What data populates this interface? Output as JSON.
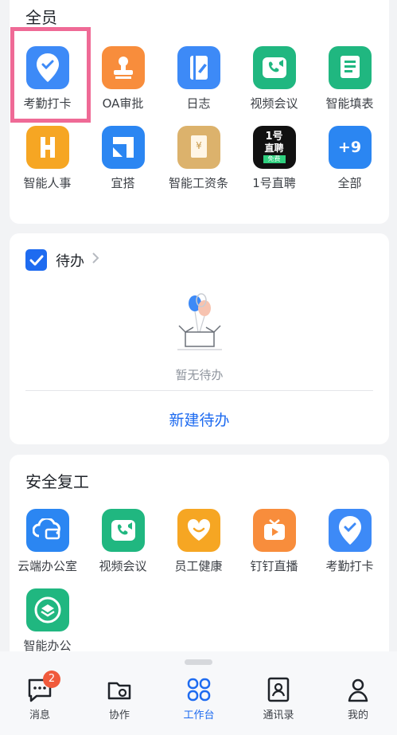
{
  "sections": {
    "all": {
      "title": "全员",
      "apps": [
        {
          "label": "考勤打卡",
          "icon": "location-check-icon",
          "color": "#3d8af7"
        },
        {
          "label": "OA审批",
          "icon": "stamp-icon",
          "color": "#f88d3c"
        },
        {
          "label": "日志",
          "icon": "journal-edit-icon",
          "color": "#3d8af7"
        },
        {
          "label": "视频会议",
          "icon": "video-call-icon",
          "color": "#20b780"
        },
        {
          "label": "智能填表",
          "icon": "form-icon",
          "color": "#20b780"
        },
        {
          "label": "智能人事",
          "icon": "h-icon",
          "color": "#f6a623"
        },
        {
          "label": "宜搭",
          "icon": "yida-icon",
          "color": "#2b86f2"
        },
        {
          "label": "智能工资条",
          "icon": "payslip-icon",
          "color": "#dcb26c"
        },
        {
          "label": "1号直聘",
          "icon": "recruit-icon",
          "color": "#111111",
          "text_lines": [
            "1号",
            "直聘",
            "免费"
          ]
        },
        {
          "label": "全部",
          "icon": "more-count-icon",
          "color": "#2b86f2",
          "text": "+9"
        }
      ]
    },
    "todo": {
      "title": "待办",
      "empty_text": "暂无待办",
      "new_label": "新建待办"
    },
    "safe": {
      "title": "安全复工",
      "apps": [
        {
          "label": "云端办公室",
          "icon": "cloud-office-icon",
          "color": "#2b86f2"
        },
        {
          "label": "视频会议",
          "icon": "video-call-icon",
          "color": "#20b780"
        },
        {
          "label": "员工健康",
          "icon": "heart-smile-icon",
          "color": "#f6a623"
        },
        {
          "label": "钉钉直播",
          "icon": "live-tv-icon",
          "color": "#f88d3c"
        },
        {
          "label": "考勤打卡",
          "icon": "location-check-icon",
          "color": "#3d8af7"
        },
        {
          "label": "智能办公",
          "icon": "layers-icon",
          "color": "#20b780"
        }
      ]
    }
  },
  "bottom_nav": [
    {
      "label": "消息",
      "icon": "chat-bubble-icon",
      "badge": "2"
    },
    {
      "label": "协作",
      "icon": "collab-folder-icon"
    },
    {
      "label": "工作台",
      "icon": "workbench-grid-icon",
      "active": true
    },
    {
      "label": "通讯录",
      "icon": "contacts-icon"
    },
    {
      "label": "我的",
      "icon": "person-icon"
    }
  ],
  "colors": {
    "accent": "#1e6bf0",
    "badge": "#f05a3c",
    "highlight": "#ef6a96"
  }
}
